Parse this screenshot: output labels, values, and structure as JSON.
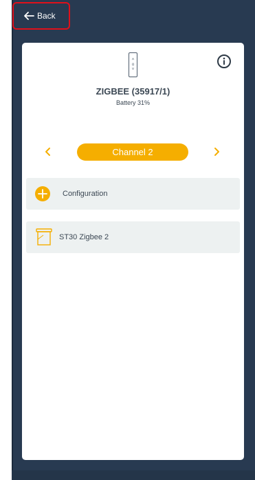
{
  "header": {
    "back_label": "Back",
    "back_icon": "arrow-left-icon"
  },
  "device": {
    "name": "ZIGBEE (35917/1)",
    "battery": "Battery 31%",
    "remote_icon_glyphs": [
      "˄",
      "o",
      "˅"
    ],
    "info_icon": "info-icon"
  },
  "channel": {
    "label": "Channel 2",
    "prev_icon": "chevron-left-icon",
    "next_icon": "chevron-right-icon"
  },
  "rows": {
    "configuration": {
      "label": "Configuration",
      "icon": "plus-icon"
    },
    "device_item": {
      "label": "ST30 Zigbee 2",
      "icon": "blind-icon"
    }
  },
  "colors": {
    "accent": "#f5ae00",
    "frame": "#283a51",
    "row_bg": "#edf1f1",
    "text": "#3b4753",
    "highlight": "#e0101a"
  }
}
